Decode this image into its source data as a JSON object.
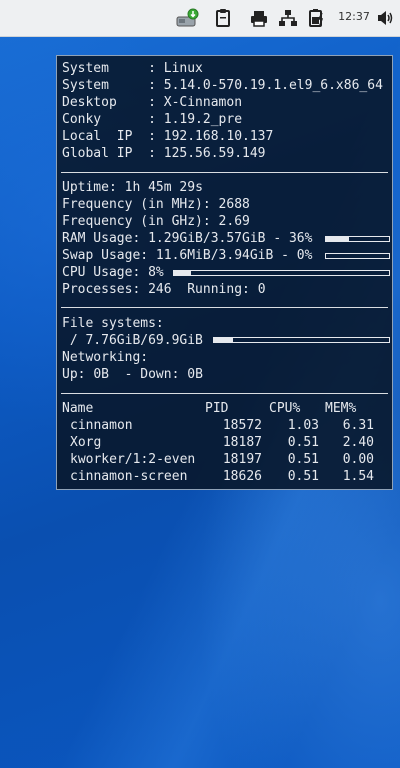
{
  "panel": {
    "clock": "12:37",
    "icons": [
      "package-updates-icon",
      "clipboard-icon",
      "printer-icon",
      "network-icon",
      "battery-icon",
      "volume-icon"
    ]
  },
  "conky": {
    "system_info": [
      {
        "label": "System     : ",
        "value": "Linux"
      },
      {
        "label": "System     : ",
        "value": "5.14.0-570.19.1.el9_6.x86_64"
      },
      {
        "label": "Desktop    : ",
        "value": "X-Cinnamon"
      },
      {
        "label": "Conky      : ",
        "value": "1.19.2_pre"
      },
      {
        "label": "Local  IP  : ",
        "value": "192.168.10.137"
      },
      {
        "label": "Global IP  : ",
        "value": "125.56.59.149"
      }
    ],
    "stats": {
      "uptime_label": "Uptime: ",
      "uptime": "1h 45m 29s",
      "freq_mhz_label": "Frequency (in MHz): ",
      "freq_mhz": "2688",
      "freq_ghz_label": "Frequency (in GHz): ",
      "freq_ghz": "2.69",
      "ram_label": "RAM Usage: ",
      "ram": "1.29GiB/3.57GiB - 36%",
      "ram_percent": 36,
      "swap_label": "Swap Usage: ",
      "swap": "11.6MiB/3.94GiB - 0%",
      "swap_percent": 0,
      "cpu_label": "CPU Usage: ",
      "cpu": "8%",
      "cpu_percent": 8,
      "processes_label": "Processes: ",
      "processes": "246",
      "running_label": "Running: ",
      "running": "0"
    },
    "filesystems": {
      "heading": "File systems:",
      "root_label": " / ",
      "root_usage": "7.76GiB/69.9GiB",
      "root_percent": 11
    },
    "networking": {
      "heading": "Networking:",
      "up_label": "Up: ",
      "up": "0B",
      "down_label": "  - Down: ",
      "down": "0B"
    },
    "processes_table": {
      "headers": [
        "Name",
        "PID",
        "CPU%",
        "MEM%"
      ],
      "rows": [
        {
          "name": "cinnamon",
          "pid": "18572",
          "cpu": "1.03",
          "mem": "6.31"
        },
        {
          "name": "Xorg",
          "pid": "18187",
          "cpu": "0.51",
          "mem": "2.40"
        },
        {
          "name": "kworker/1:2-even",
          "pid": "18197",
          "cpu": "0.51",
          "mem": "0.00"
        },
        {
          "name": "cinnamon-screen",
          "pid": "18626",
          "cpu": "0.51",
          "mem": "1.54"
        }
      ]
    }
  }
}
